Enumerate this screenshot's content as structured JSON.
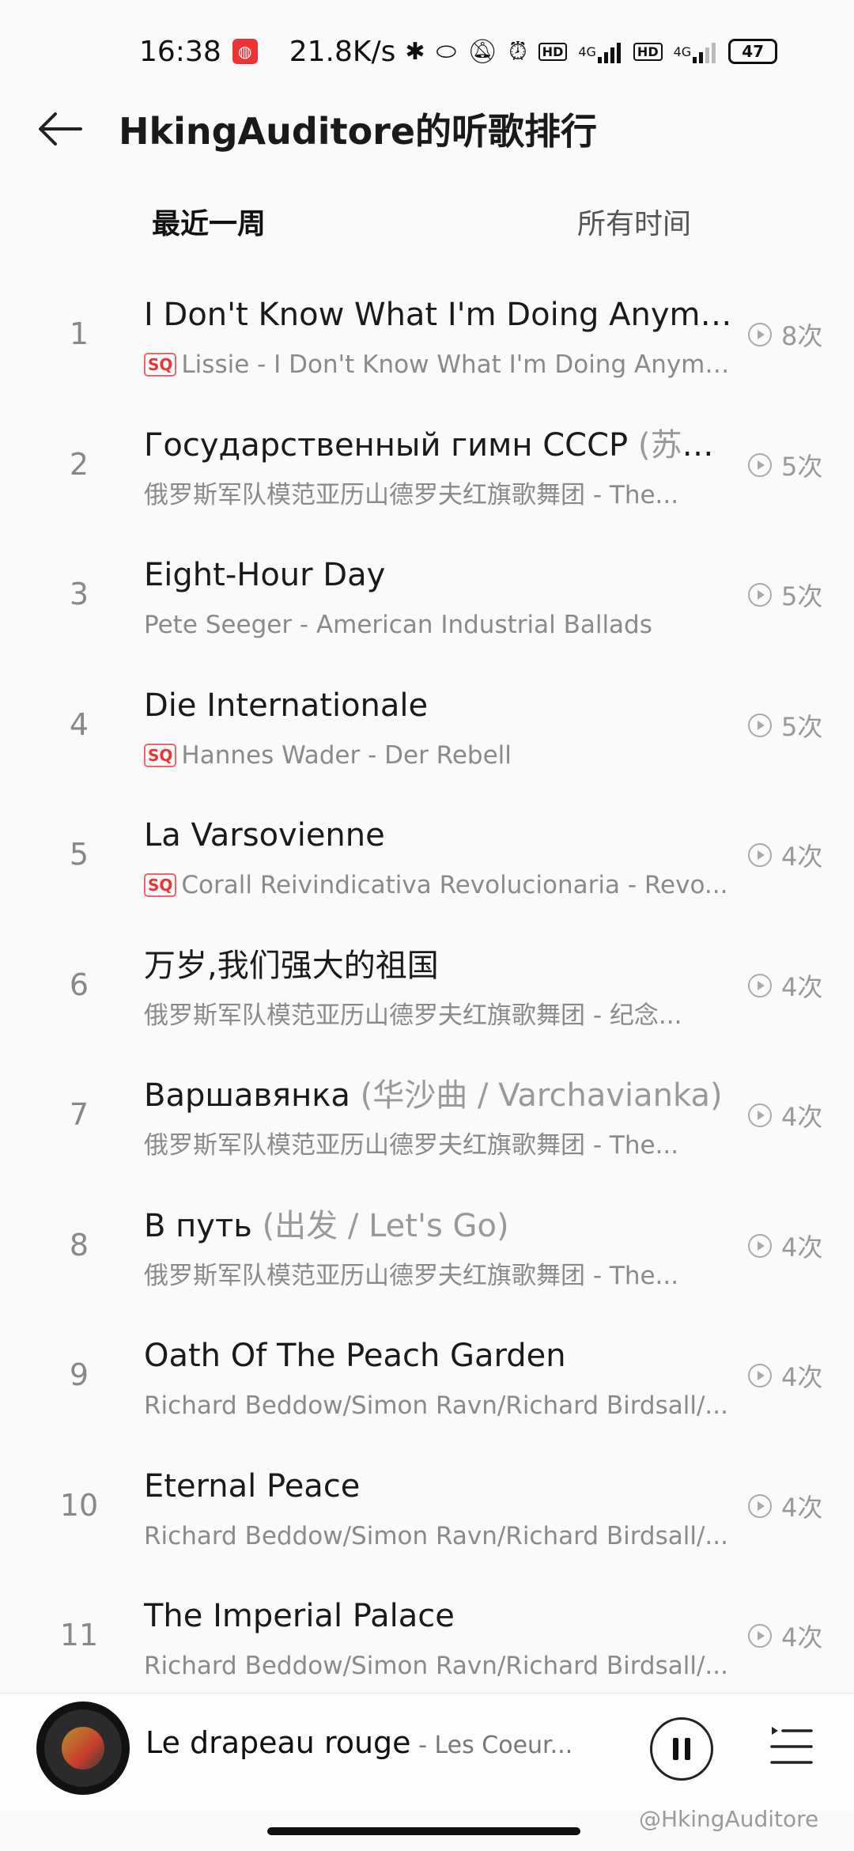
{
  "status_bar": {
    "time": "16:38",
    "app_badge": "◍",
    "netspeed": "21.8K/s",
    "net_type_1": "4G",
    "net_type_2": "4G",
    "battery": "47"
  },
  "header": {
    "title": "HkingAuditore的听歌排行"
  },
  "tabs": [
    {
      "label": "最近一周",
      "active": true
    },
    {
      "label": "所有时间",
      "active": false
    }
  ],
  "songs": [
    {
      "rank": "1",
      "title": "I Don't Know What I'm Doing Anymore",
      "subtitle": "",
      "sq": true,
      "meta": "Lissie - I Don't Know What I'm Doing Anymore",
      "plays": "8次"
    },
    {
      "rank": "2",
      "title": "Государственный гимн СССР",
      "subtitle": " (苏联国歌)",
      "sq": false,
      "meta": "俄罗斯军队模范亚历山德罗夫红旗歌舞团 - The...",
      "plays": "5次"
    },
    {
      "rank": "3",
      "title": "Eight-Hour Day",
      "subtitle": "",
      "sq": false,
      "meta": "Pete Seeger - American Industrial Ballads",
      "plays": "5次"
    },
    {
      "rank": "4",
      "title": "Die Internationale",
      "subtitle": "",
      "sq": true,
      "meta": "Hannes Wader - Der Rebell",
      "plays": "5次"
    },
    {
      "rank": "5",
      "title": "La Varsovienne",
      "subtitle": "",
      "sq": true,
      "meta": "Corall Reivindicativa Revolucionaria - Revo...",
      "plays": "4次"
    },
    {
      "rank": "6",
      "title": "万岁,我们强大的祖国",
      "subtitle": "",
      "sq": false,
      "meta": "俄罗斯军队模范亚历山德罗夫红旗歌舞团 - 纪念...",
      "plays": "4次"
    },
    {
      "rank": "7",
      "title": "Варшавянка",
      "subtitle": " (华沙曲 / Varchavianka)",
      "sq": false,
      "meta": "俄罗斯军队模范亚历山德罗夫红旗歌舞团 - The...",
      "plays": "4次"
    },
    {
      "rank": "8",
      "title": "В путь",
      "subtitle": " (出发 / Let's Go)",
      "sq": false,
      "meta": "俄罗斯军队模范亚历山德罗夫红旗歌舞团 - The...",
      "plays": "4次"
    },
    {
      "rank": "9",
      "title": "Oath Of The Peach Garden",
      "subtitle": "",
      "sq": false,
      "meta": "Richard Beddow/Simon Ravn/Richard Birdsall/...",
      "plays": "4次"
    },
    {
      "rank": "10",
      "title": "Eternal Peace",
      "subtitle": "",
      "sq": false,
      "meta": "Richard Beddow/Simon Ravn/Richard Birdsall/...",
      "plays": "4次"
    },
    {
      "rank": "11",
      "title": "The Imperial Palace",
      "subtitle": "",
      "sq": false,
      "meta": "Richard Beddow/Simon Ravn/Richard Birdsall/...",
      "plays": "4次"
    }
  ],
  "sq_label": "SQ",
  "player": {
    "title": "Le drapeau rouge",
    "artist": " - Les Coeur..."
  },
  "watermark": "@HkingAuditore",
  "colors": {
    "accent": "#f2545b",
    "sq": "#e33333"
  }
}
